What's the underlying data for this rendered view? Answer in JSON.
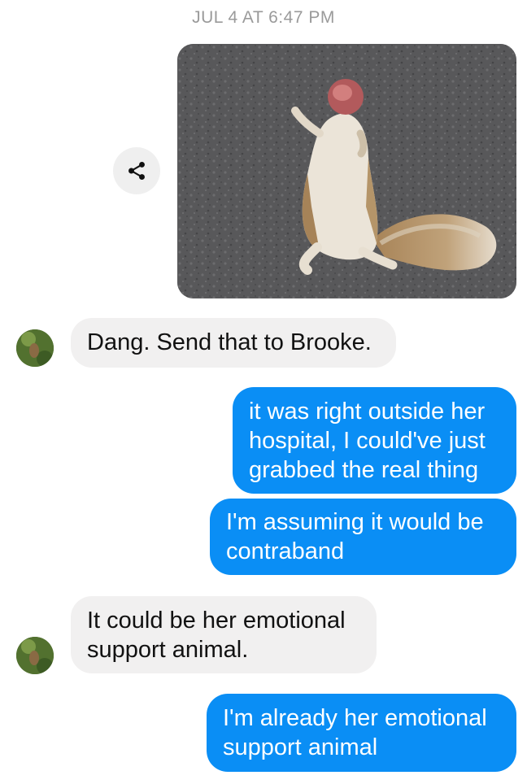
{
  "thread": {
    "timestamp": "JUL 4 AT 6:47 PM"
  },
  "colors": {
    "incoming_bubble": "#f1f0f0",
    "outgoing_bubble": "#0a8ef5",
    "timestamp_text": "#9a9a9a"
  },
  "icons": {
    "share": "share-icon",
    "avatar": "contact-avatar"
  },
  "messages": [
    {
      "direction": "incoming",
      "lines": [
        "Dang. Send that to Brooke."
      ]
    },
    {
      "direction": "outgoing",
      "lines": [
        "it was right outside her",
        "hospital, I could've just",
        "grabbed the real thing"
      ]
    },
    {
      "direction": "outgoing",
      "lines": [
        "I'm assuming it would be",
        "contraband"
      ]
    },
    {
      "direction": "incoming",
      "lines": [
        "It could be her emotional",
        "support animal."
      ]
    },
    {
      "direction": "outgoing",
      "lines": [
        "I'm already her emotional",
        "support animal"
      ]
    }
  ]
}
